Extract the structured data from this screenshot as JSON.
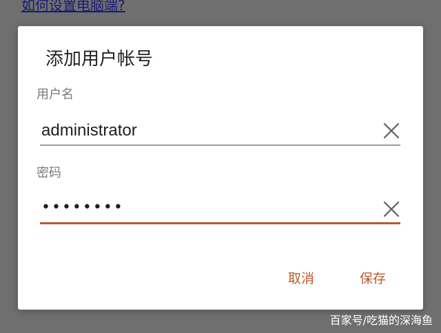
{
  "background": {
    "help_link": "如何设置电脑端?"
  },
  "dialog": {
    "title": "添加用户帐号",
    "username": {
      "label": "用户名",
      "value": "administrator",
      "clear_icon": "close-icon"
    },
    "password": {
      "label": "密码",
      "value": "••••••••",
      "clear_icon": "close-icon"
    },
    "buttons": {
      "cancel": "取消",
      "save": "保存"
    }
  },
  "watermark": "百家号/吃猫的深海鱼",
  "colors": {
    "accent": "#c0572a",
    "button_text": "#b75a2c",
    "overlay": "#6f6f6f",
    "inactive_underline": "#9a9a9a"
  }
}
